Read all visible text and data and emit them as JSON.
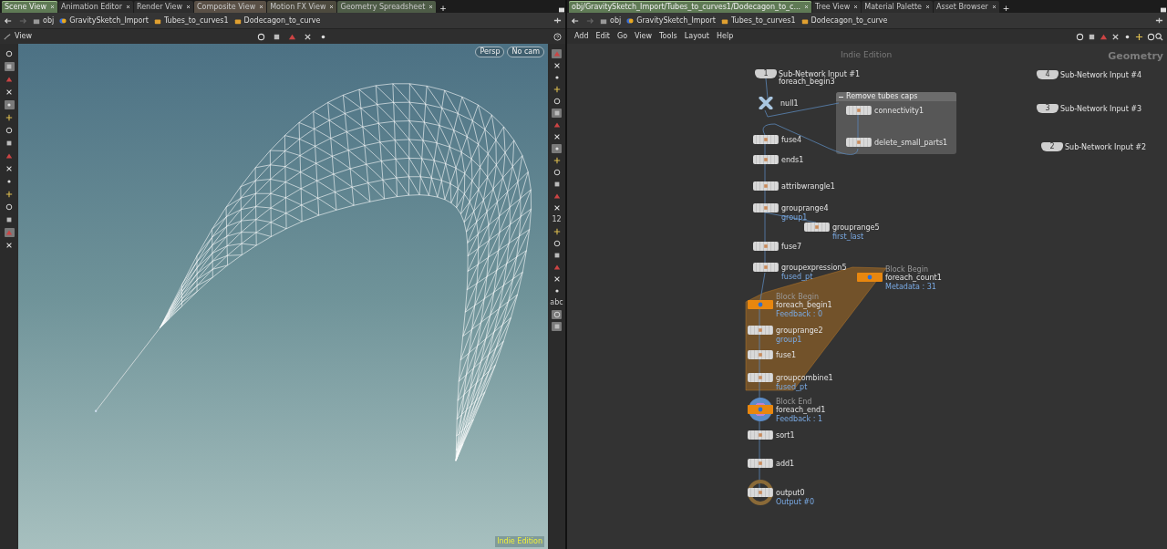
{
  "left_pane": {
    "tabs": [
      {
        "label": "Scene View",
        "selected": true,
        "color": "#5f7a55"
      },
      {
        "label": "Animation Editor",
        "selected": false,
        "color": "#2e2e2e"
      },
      {
        "label": "Render View",
        "selected": false,
        "color": "#2e2e2e"
      },
      {
        "label": "Composite View",
        "selected": false,
        "color": "#5a5046"
      },
      {
        "label": "Motion FX View",
        "selected": false,
        "color": "#4d4a3e"
      },
      {
        "label": "Geometry Spreadsheet",
        "selected": false,
        "color": "#4e5c47"
      }
    ],
    "add_tab": "+",
    "path": [
      "obj",
      "GravitySketch_Import",
      "Tubes_to_curves1",
      "Dodecagon_to_curve"
    ],
    "toolbar_title": "View",
    "viewport": {
      "camera_buttons": [
        "Persp",
        "No cam"
      ],
      "edition": "Indie Edition"
    },
    "left_toolbar": [
      {
        "selected": false
      },
      {
        "selected": true
      },
      {
        "selected": false
      },
      {
        "selected": false
      },
      {
        "selected": true
      },
      {
        "selected": false
      },
      {
        "selected": false
      },
      {
        "selected": false
      },
      {
        "selected": false
      },
      {
        "selected": false
      },
      {
        "selected": false
      },
      {
        "selected": false
      },
      {
        "selected": false
      },
      {
        "selected": false
      },
      {
        "selected": true
      },
      {
        "selected": false
      }
    ],
    "right_toolbar": [
      {
        "kind": "icon",
        "selected": true
      },
      {
        "kind": "icon",
        "selected": false
      },
      {
        "kind": "icon",
        "selected": false
      },
      {
        "kind": "icon",
        "selected": false
      },
      {
        "kind": "icon",
        "selected": false
      },
      {
        "kind": "icon",
        "selected": true
      },
      {
        "kind": "icon",
        "selected": false
      },
      {
        "kind": "icon",
        "selected": false
      },
      {
        "kind": "icon",
        "selected": true
      },
      {
        "kind": "icon",
        "selected": false
      },
      {
        "kind": "icon",
        "selected": false
      },
      {
        "kind": "icon",
        "selected": false
      },
      {
        "kind": "icon",
        "selected": false
      },
      {
        "kind": "icon",
        "selected": false
      },
      {
        "kind": "text",
        "text": "12",
        "selected": false
      },
      {
        "kind": "icon",
        "selected": false
      },
      {
        "kind": "icon",
        "selected": false
      },
      {
        "kind": "icon",
        "selected": false
      },
      {
        "kind": "icon",
        "selected": false
      },
      {
        "kind": "icon",
        "selected": false
      },
      {
        "kind": "icon",
        "selected": false
      },
      {
        "kind": "text",
        "text": "abc",
        "selected": false
      },
      {
        "kind": "icon",
        "selected": true
      },
      {
        "kind": "icon",
        "selected": true
      }
    ]
  },
  "right_pane": {
    "tabs": [
      {
        "label": "obj/GravitySketch_Import/Tubes_to_curves1/Dodecagon_to_c...",
        "selected": true,
        "color": "#5f7a55"
      },
      {
        "label": "Tree View",
        "selected": false,
        "color": "#2e2e2e"
      },
      {
        "label": "Material Palette",
        "selected": false,
        "color": "#2e2e2e"
      },
      {
        "label": "Asset Browser",
        "selected": false,
        "color": "#2e2e2e"
      }
    ],
    "add_tab": "+",
    "path": [
      "obj",
      "GravitySketch_Import",
      "Tubes_to_curves1",
      "Dodecagon_to_curve"
    ],
    "menu": [
      "Add",
      "Edit",
      "Go",
      "View",
      "Tools",
      "Layout",
      "Help"
    ],
    "network": {
      "edition": "Indie Edition",
      "context": "Geometry",
      "network_box": {
        "title": "Remove tubes caps"
      },
      "nodes": [
        {
          "kind": "input",
          "number": "1",
          "name": "Sub-Network Input #1",
          "comment": "foreach_begin3"
        },
        {
          "kind": "null",
          "name": "null1"
        },
        {
          "kind": "sop",
          "name": "connectivity1"
        },
        {
          "kind": "sop",
          "name": "delete_small_parts1"
        },
        {
          "kind": "sop",
          "name": "fuse4"
        },
        {
          "kind": "sop",
          "name": "ends1"
        },
        {
          "kind": "sop",
          "name": "attribwrangle1"
        },
        {
          "kind": "sop",
          "name": "grouprange4",
          "info": "group1"
        },
        {
          "kind": "sop",
          "name": "grouprange5",
          "info": "first_last"
        },
        {
          "kind": "sop",
          "name": "fuse7"
        },
        {
          "kind": "sop",
          "name": "groupexpression5",
          "info": "fused_pt"
        },
        {
          "kind": "block",
          "tag": "Block Begin",
          "name": "foreach_count1",
          "info": "Metadata : 31"
        },
        {
          "kind": "block",
          "tag": "Block Begin",
          "name": "foreach_begin1",
          "info": "Feedback : 0"
        },
        {
          "kind": "sop",
          "name": "grouprange2",
          "info": "group1"
        },
        {
          "kind": "sop",
          "name": "fuse1"
        },
        {
          "kind": "sop",
          "name": "groupcombine1",
          "info": "fused_pt"
        },
        {
          "kind": "block",
          "tag": "Block End",
          "name": "foreach_end1",
          "info": "Feedback : 1",
          "display": true
        },
        {
          "kind": "sop",
          "name": "sort1"
        },
        {
          "kind": "sop",
          "name": "add1"
        },
        {
          "kind": "output",
          "name": "output0",
          "info": "Output #0"
        },
        {
          "kind": "input",
          "number": "4",
          "name": "Sub-Network Input #4"
        },
        {
          "kind": "input",
          "number": "3",
          "name": "Sub-Network Input #3"
        },
        {
          "kind": "input",
          "number": "2",
          "name": "Sub-Network Input #2"
        }
      ]
    }
  }
}
